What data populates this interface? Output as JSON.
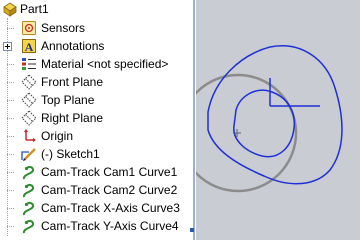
{
  "tree": {
    "root": {
      "label": "Part1",
      "icon": "part-icon"
    },
    "items": [
      {
        "label": "Sensors",
        "icon": "sensor-icon",
        "expandable": false
      },
      {
        "label": "Annotations",
        "icon": "annotation-icon",
        "expandable": true
      },
      {
        "label": "Material <not specified>",
        "icon": "material-icon",
        "expandable": false
      },
      {
        "label": "Front Plane",
        "icon": "plane-icon",
        "expandable": false
      },
      {
        "label": "Top Plane",
        "icon": "plane-icon",
        "expandable": false
      },
      {
        "label": "Right Plane",
        "icon": "plane-icon",
        "expandable": false
      },
      {
        "label": "Origin",
        "icon": "origin-icon",
        "expandable": false
      },
      {
        "label": "(-) Sketch1",
        "icon": "sketch-icon",
        "expandable": false
      },
      {
        "label": "Cam-Track  Cam1 Curve1",
        "icon": "curve-icon",
        "expandable": false
      },
      {
        "label": "Cam-Track  Cam2 Curve2",
        "icon": "curve-icon",
        "expandable": false
      },
      {
        "label": "Cam-Track  X-Axis Curve3",
        "icon": "curve-icon",
        "expandable": false
      },
      {
        "label": "Cam-Track  Y-Axis Curve4",
        "icon": "curve-icon",
        "expandable": false
      }
    ]
  },
  "colors": {
    "viewport_bg": "#c9ccd2",
    "curve_blue": "#1f2fd6",
    "circle_gray": "#8c8c8c",
    "icon_green": "#2e8b2e",
    "icon_yellow": "#f0c020"
  }
}
